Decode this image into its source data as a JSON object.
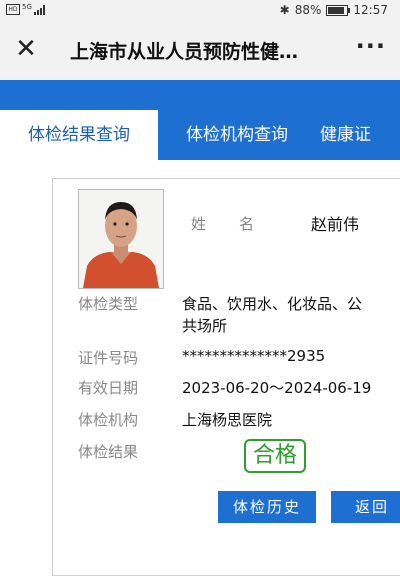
{
  "status_bar": {
    "net": "5G",
    "battery": "88%",
    "time": "12:57",
    "battery_level": 0.88
  },
  "header": {
    "title": "上海市从业人员预防性健…",
    "close_icon": "close-icon",
    "more_icon": "more-icon"
  },
  "tabs": [
    {
      "label": "体检结果查询",
      "active": true
    },
    {
      "label": "体检机构查询",
      "active": false
    },
    {
      "label": "健康证",
      "active": false
    }
  ],
  "record": {
    "name_label": [
      "姓",
      "名"
    ],
    "name": "赵前伟",
    "fields": [
      {
        "label": "体检类型",
        "value_line1": "食品、饮用水、化妆品、公",
        "value_line2": "共场所"
      },
      {
        "label": "证件号码",
        "value": "**************2935"
      },
      {
        "label": "有效日期",
        "value": "2023-06-20～2024-06-19"
      },
      {
        "label": "体检机构",
        "value": "上海杨思医院"
      },
      {
        "label": "体检结果",
        "value": "合格"
      }
    ]
  },
  "buttons": {
    "history": "体检历史",
    "back": "返回"
  },
  "colors": {
    "brand_blue": "#1e6fd2",
    "pass_green": "#2e9e2e"
  }
}
